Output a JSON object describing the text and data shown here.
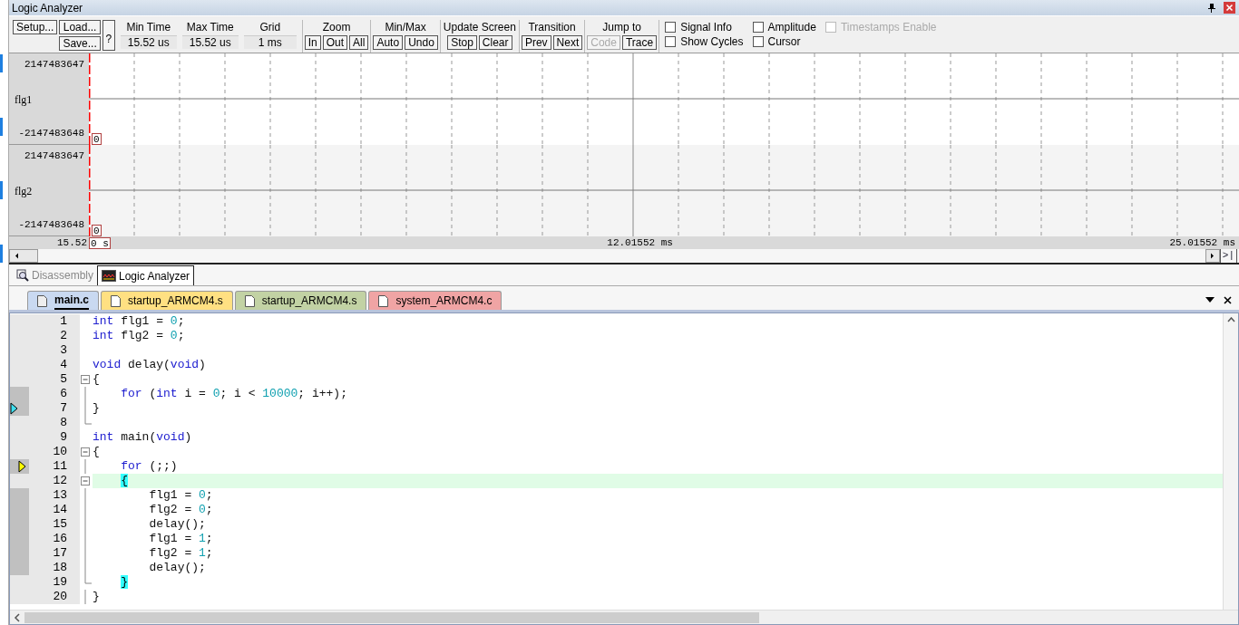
{
  "window": {
    "title": "Logic Analyzer"
  },
  "toolbar": {
    "file_buttons": [
      {
        "label": "Setup..."
      },
      {
        "label": "Load..."
      },
      {
        "label": "Save..."
      }
    ],
    "help_button": "?",
    "time_fields": [
      {
        "label": "Min Time",
        "value": "15.52 us"
      },
      {
        "label": "Max Time",
        "value": "15.52 us"
      },
      {
        "label": "Grid",
        "value": "1 ms"
      }
    ],
    "groups": [
      {
        "title": "Zoom",
        "buttons": [
          {
            "label": "In",
            "disabled": false
          },
          {
            "label": "Out",
            "disabled": false
          },
          {
            "label": "All",
            "disabled": false
          }
        ]
      },
      {
        "title": "Min/Max",
        "buttons": [
          {
            "label": "Auto",
            "disabled": false
          },
          {
            "label": "Undo",
            "disabled": false
          }
        ]
      },
      {
        "title": "Update Screen",
        "buttons": [
          {
            "label": "Stop",
            "disabled": false
          },
          {
            "label": "Clear",
            "disabled": false
          }
        ]
      },
      {
        "title": "Transition",
        "buttons": [
          {
            "label": "Prev",
            "disabled": false
          },
          {
            "label": "Next",
            "disabled": false
          }
        ]
      },
      {
        "title": "Jump to",
        "buttons": [
          {
            "label": "Code",
            "disabled": true
          },
          {
            "label": "Trace",
            "disabled": false
          }
        ]
      }
    ],
    "checkboxes": [
      {
        "label": "Signal Info",
        "checked": false,
        "disabled": false
      },
      {
        "label": "Amplitude",
        "checked": false,
        "disabled": false
      },
      {
        "label": "Timestamps Enable",
        "checked": false,
        "disabled": true
      },
      {
        "label": "Show Cycles",
        "checked": false,
        "disabled": false
      },
      {
        "label": "Cursor",
        "checked": false,
        "disabled": false
      }
    ]
  },
  "signals": [
    {
      "name": "flg1",
      "max": "2147483647",
      "min": "-2147483648",
      "value": "0"
    },
    {
      "name": "flg2",
      "max": "2147483647",
      "min": "-2147483648",
      "value": "0"
    }
  ],
  "time_axis": {
    "cursor_time": "15.52",
    "start": "0 s",
    "middle": "12.01552 ms",
    "end": "25.01552 ms"
  },
  "scroll_end_button": ">|",
  "view_tabs": [
    {
      "label": "Disassembly",
      "selected": false
    },
    {
      "label": "Logic Analyzer",
      "selected": true
    }
  ],
  "file_tabs": [
    {
      "label": "main.c",
      "selected": true,
      "color": "#c9d9f1"
    },
    {
      "label": "startup_ARMCM4.s",
      "selected": false,
      "color": "#ffe082"
    },
    {
      "label": "startup_ARMCM4.s",
      "selected": false,
      "color": "#c2d2a4"
    },
    {
      "label": "system_ARMCM4.c",
      "selected": false,
      "color": "#f0a4a4"
    }
  ],
  "code_lines": [
    {
      "number": "1",
      "covered": false,
      "call_marker": false,
      "current_marker": false,
      "fold_toggle": false,
      "fold_guide": false,
      "fold_end": false,
      "highlighted": false,
      "segments": [
        {
          "text": "int",
          "kind": "kw"
        },
        {
          "text": " flg1 = ",
          "kind": "plain"
        },
        {
          "text": "0",
          "kind": "num"
        },
        {
          "text": ";",
          "kind": "plain"
        }
      ]
    },
    {
      "number": "2",
      "covered": false,
      "call_marker": false,
      "current_marker": false,
      "fold_toggle": false,
      "fold_guide": false,
      "fold_end": false,
      "highlighted": false,
      "segments": [
        {
          "text": "int",
          "kind": "kw"
        },
        {
          "text": " flg2 = ",
          "kind": "plain"
        },
        {
          "text": "0",
          "kind": "num"
        },
        {
          "text": ";",
          "kind": "plain"
        }
      ]
    },
    {
      "number": "3",
      "covered": false,
      "call_marker": false,
      "current_marker": false,
      "fold_toggle": false,
      "fold_guide": false,
      "fold_end": false,
      "highlighted": false
    },
    {
      "number": "4",
      "covered": false,
      "call_marker": false,
      "current_marker": false,
      "fold_toggle": false,
      "fold_guide": false,
      "fold_end": false,
      "highlighted": false,
      "segments": [
        {
          "text": "void",
          "kind": "kw"
        },
        {
          "text": " delay(",
          "kind": "plain"
        },
        {
          "text": "void",
          "kind": "kw"
        },
        {
          "text": ")",
          "kind": "plain"
        }
      ]
    },
    {
      "number": "5",
      "covered": false,
      "call_marker": false,
      "current_marker": false,
      "fold_toggle": true,
      "fold_guide": false,
      "fold_end": false,
      "highlighted": false,
      "segments": [
        {
          "text": "{",
          "kind": "plain"
        }
      ]
    },
    {
      "number": "6",
      "covered": true,
      "call_marker": false,
      "current_marker": false,
      "fold_toggle": false,
      "fold_guide": true,
      "fold_end": false,
      "highlighted": false,
      "segments": [
        {
          "text": "    for",
          "kind": "kw"
        },
        {
          "text": " (",
          "kind": "plain"
        },
        {
          "text": "int",
          "kind": "kw"
        },
        {
          "text": " i = ",
          "kind": "plain"
        },
        {
          "text": "0",
          "kind": "num"
        },
        {
          "text": "; i < ",
          "kind": "plain"
        },
        {
          "text": "10000",
          "kind": "num"
        },
        {
          "text": "; i++);",
          "kind": "plain"
        }
      ]
    },
    {
      "number": "7",
      "covered": true,
      "call_marker": true,
      "current_marker": false,
      "fold_toggle": false,
      "fold_guide": true,
      "fold_end": false,
      "highlighted": false,
      "segments": [
        {
          "text": "}",
          "kind": "plain"
        }
      ]
    },
    {
      "number": "8",
      "covered": false,
      "call_marker": false,
      "current_marker": false,
      "fold_toggle": false,
      "fold_guide": false,
      "fold_end": true,
      "highlighted": false
    },
    {
      "number": "9",
      "covered": false,
      "call_marker": false,
      "current_marker": false,
      "fold_toggle": false,
      "fold_guide": false,
      "fold_end": false,
      "highlighted": false,
      "segments": [
        {
          "text": "int",
          "kind": "kw"
        },
        {
          "text": " main(",
          "kind": "plain"
        },
        {
          "text": "void",
          "kind": "kw"
        },
        {
          "text": ")",
          "kind": "plain"
        }
      ]
    },
    {
      "number": "10",
      "covered": false,
      "call_marker": false,
      "current_marker": false,
      "fold_toggle": true,
      "fold_guide": false,
      "fold_end": false,
      "highlighted": false,
      "segments": [
        {
          "text": "{",
          "kind": "plain"
        }
      ]
    },
    {
      "number": "11",
      "covered": true,
      "call_marker": false,
      "current_marker": true,
      "fold_toggle": false,
      "fold_guide": true,
      "fold_end": false,
      "highlighted": false,
      "segments": [
        {
          "text": "    for",
          "kind": "kw"
        },
        {
          "text": " (;;)",
          "kind": "plain"
        }
      ]
    },
    {
      "number": "12",
      "covered": false,
      "call_marker": false,
      "current_marker": false,
      "fold_toggle": true,
      "fold_guide": false,
      "fold_end": false,
      "highlighted": true,
      "segments": [
        {
          "text": "    {",
          "kind": "brace"
        }
      ]
    },
    {
      "number": "13",
      "covered": true,
      "call_marker": false,
      "current_marker": false,
      "fold_toggle": false,
      "fold_guide": true,
      "fold_end": false,
      "highlighted": false,
      "segments": [
        {
          "text": "        flg1 = ",
          "kind": "plain"
        },
        {
          "text": "0",
          "kind": "num"
        },
        {
          "text": ";",
          "kind": "plain"
        }
      ]
    },
    {
      "number": "14",
      "covered": true,
      "call_marker": false,
      "current_marker": false,
      "fold_toggle": false,
      "fold_guide": true,
      "fold_end": false,
      "highlighted": false,
      "segments": [
        {
          "text": "        flg2 = ",
          "kind": "plain"
        },
        {
          "text": "0",
          "kind": "num"
        },
        {
          "text": ";",
          "kind": "plain"
        }
      ]
    },
    {
      "number": "15",
      "covered": true,
      "call_marker": false,
      "current_marker": false,
      "fold_toggle": false,
      "fold_guide": true,
      "fold_end": false,
      "highlighted": false,
      "segments": [
        {
          "text": "        delay();",
          "kind": "plain"
        }
      ]
    },
    {
      "number": "16",
      "covered": true,
      "call_marker": false,
      "current_marker": false,
      "fold_toggle": false,
      "fold_guide": true,
      "fold_end": false,
      "highlighted": false,
      "segments": [
        {
          "text": "        flg1 = ",
          "kind": "plain"
        },
        {
          "text": "1",
          "kind": "num"
        },
        {
          "text": ";",
          "kind": "plain"
        }
      ]
    },
    {
      "number": "17",
      "covered": true,
      "call_marker": false,
      "current_marker": false,
      "fold_toggle": false,
      "fold_guide": true,
      "fold_end": false,
      "highlighted": false,
      "segments": [
        {
          "text": "        flg2 = ",
          "kind": "plain"
        },
        {
          "text": "1",
          "kind": "num"
        },
        {
          "text": ";",
          "kind": "plain"
        }
      ]
    },
    {
      "number": "18",
      "covered": true,
      "call_marker": false,
      "current_marker": false,
      "fold_toggle": false,
      "fold_guide": true,
      "fold_end": false,
      "highlighted": false,
      "segments": [
        {
          "text": "        delay();",
          "kind": "plain"
        }
      ]
    },
    {
      "number": "19",
      "covered": false,
      "call_marker": false,
      "current_marker": false,
      "fold_toggle": false,
      "fold_guide": false,
      "fold_end": true,
      "highlighted": false,
      "segments": [
        {
          "text": "    }",
          "kind": "brace"
        }
      ]
    },
    {
      "number": "20",
      "covered": false,
      "call_marker": false,
      "current_marker": false,
      "fold_toggle": false,
      "fold_guide": true,
      "fold_end": false,
      "highlighted": false,
      "segments": [
        {
          "text": "}",
          "kind": "plain"
        }
      ]
    }
  ]
}
